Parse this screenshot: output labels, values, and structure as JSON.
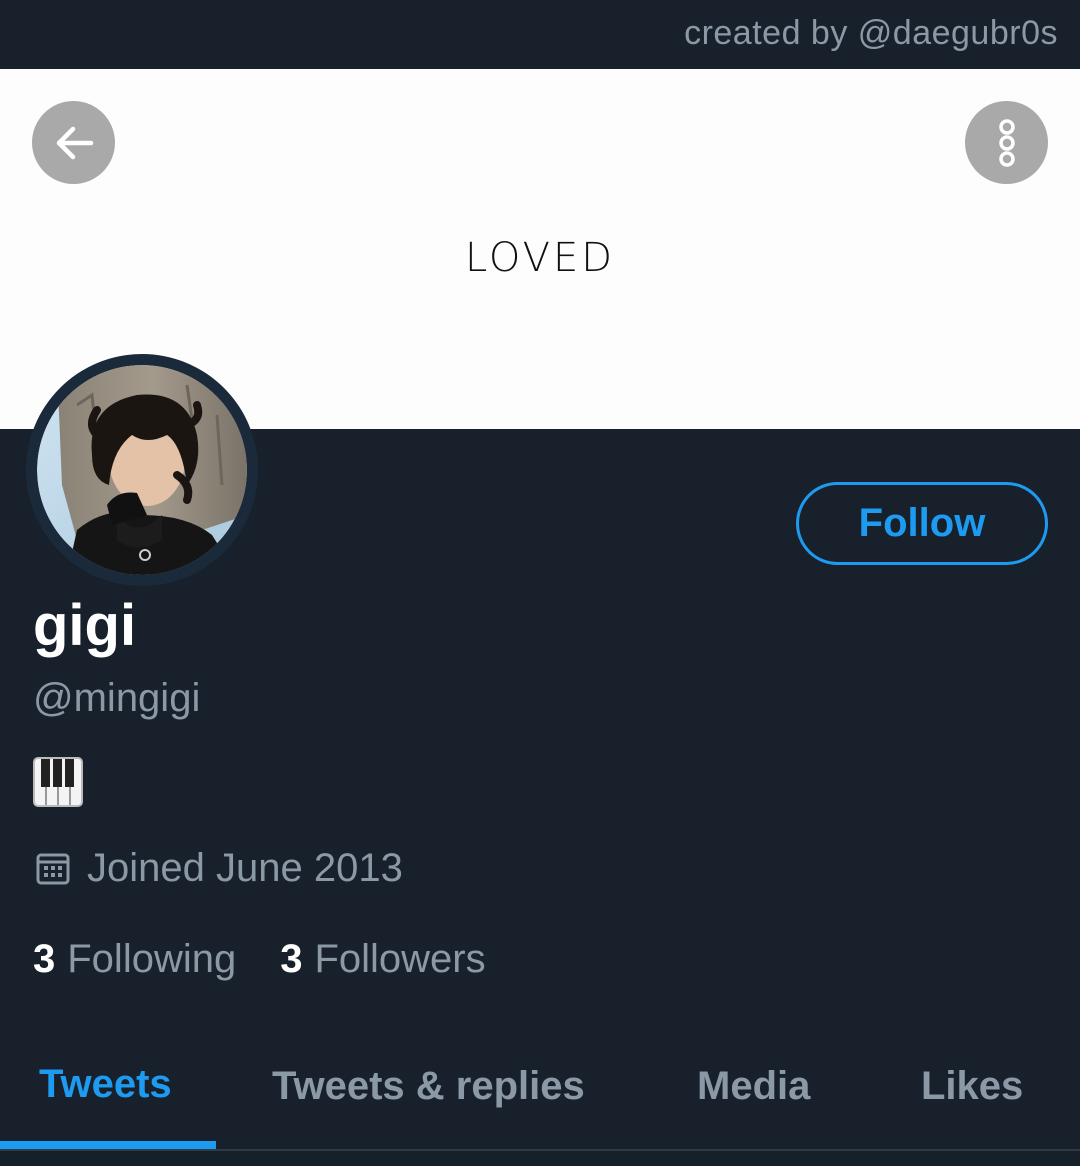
{
  "credit": {
    "text": "created by @daegubr0s"
  },
  "header": {
    "banner_text": "LOVED",
    "back_icon": "arrow-left-icon",
    "more_icon": "more-vertical-icon"
  },
  "profile": {
    "display_name": "gigi",
    "handle": "@mingigi",
    "bio_emoji": "piano-keys-emoji",
    "joined": "Joined June 2013",
    "follow_label": "Follow",
    "following_count": "3",
    "following_label": "Following",
    "followers_count": "3",
    "followers_label": "Followers"
  },
  "tabs": [
    {
      "label": "Tweets",
      "active": true
    },
    {
      "label": "Tweets & replies",
      "active": false
    },
    {
      "label": "Media",
      "active": false
    },
    {
      "label": "Likes",
      "active": false
    }
  ],
  "colors": {
    "background": "#18202b",
    "accent": "#1d9bf0",
    "secondary_text": "#8b98a5",
    "banner": "#fdfdfd"
  }
}
